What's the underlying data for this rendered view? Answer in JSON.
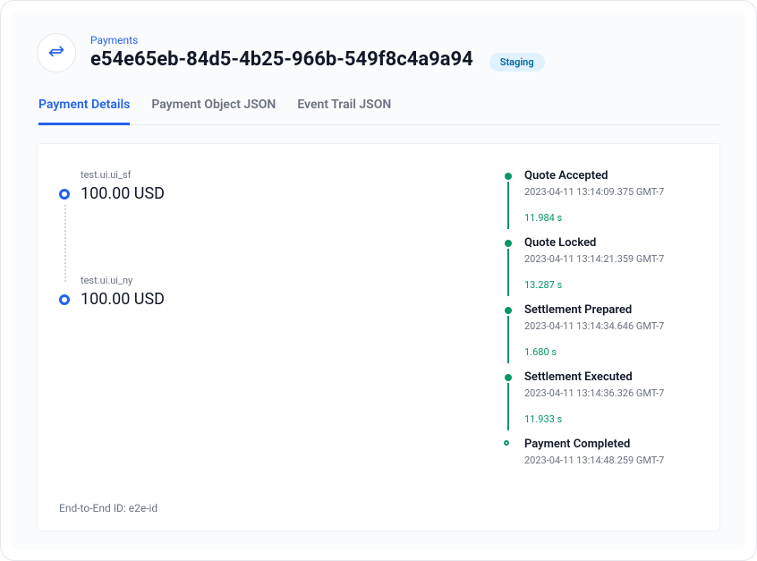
{
  "header": {
    "breadcrumb": "Payments",
    "title": "e54e65eb-84d5-4b25-966b-549f8c4a9a94",
    "badge": "Staging"
  },
  "tabs": [
    {
      "label": "Payment Details",
      "active": true
    },
    {
      "label": "Payment Object JSON",
      "active": false
    },
    {
      "label": "Event Trail JSON",
      "active": false
    }
  ],
  "parties": [
    {
      "name": "test.ui.ui_sf",
      "amount": "100.00 USD"
    },
    {
      "name": "test.ui.ui_ny",
      "amount": "100.00 USD"
    }
  ],
  "e2e_label": "End-to-End ID: e2e-id",
  "timeline": [
    {
      "title": "Quote Accepted",
      "ts": "2023-04-11 13:14:09.375 GMT-7",
      "dur": "11.984 s"
    },
    {
      "title": "Quote Locked",
      "ts": "2023-04-11 13:14:21.359 GMT-7",
      "dur": "13.287 s"
    },
    {
      "title": "Settlement Prepared",
      "ts": "2023-04-11 13:14:34.646 GMT-7",
      "dur": "1.680 s"
    },
    {
      "title": "Settlement Executed",
      "ts": "2023-04-11 13:14:36.326 GMT-7",
      "dur": "11.933 s"
    },
    {
      "title": "Payment Completed",
      "ts": "2023-04-11 13:14:48.259 GMT-7",
      "dur": null
    }
  ],
  "colors": {
    "accent": "#2563eb",
    "success": "#059669",
    "badge_bg": "#e0f2fe"
  }
}
